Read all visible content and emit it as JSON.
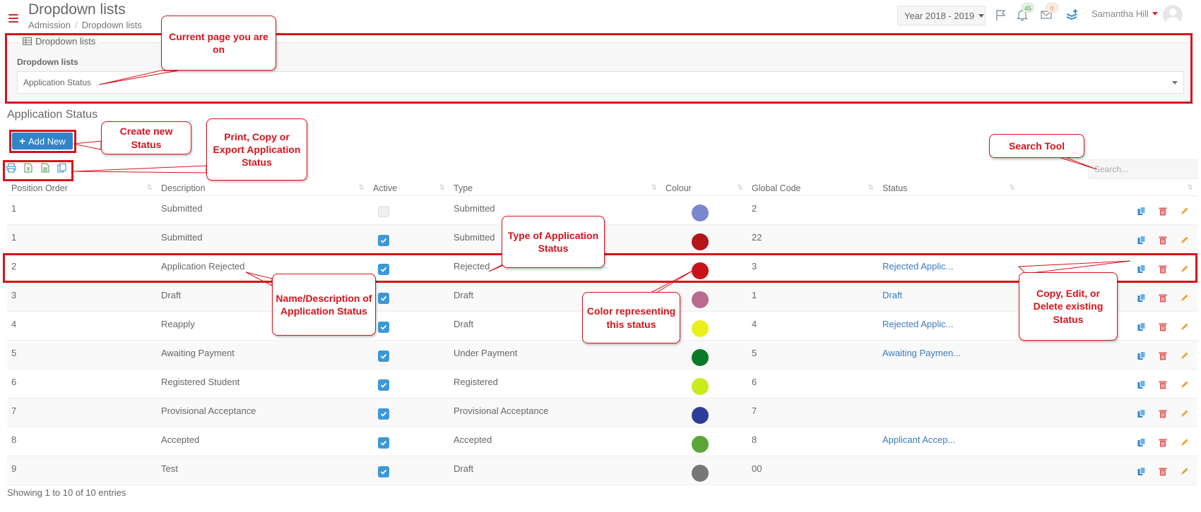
{
  "header": {
    "title": "Dropdown lists",
    "breadcrumb": [
      "Admission",
      "Dropdown lists"
    ],
    "year_select": "Year 2018 - 2019",
    "notifications_count": "45",
    "messages_count": "0",
    "user_name": "Samantha Hill"
  },
  "panel": {
    "legend": "Dropdown lists",
    "label": "Dropdown lists",
    "selected": "Application Status"
  },
  "section_title": "Application Status",
  "add_button": "Add New",
  "search": {
    "placeholder": "Search..."
  },
  "table": {
    "columns": [
      "Position Order",
      "Description",
      "Active",
      "Type",
      "Colour",
      "Global Code",
      "Status"
    ],
    "rows": [
      {
        "order": "1",
        "description": "Submitted",
        "active": false,
        "type": "Submitted",
        "colour": "#7b86cf",
        "global_code": "2",
        "status": ""
      },
      {
        "order": "1",
        "description": "Submitted",
        "active": true,
        "type": "Submitted",
        "colour": "#b3161a",
        "global_code": "22",
        "status": ""
      },
      {
        "order": "2",
        "description": "Application Rejected",
        "active": true,
        "type": "Rejected",
        "colour": "#c81418",
        "global_code": "3",
        "status": "Rejected Applic..."
      },
      {
        "order": "3",
        "description": "Draft",
        "active": true,
        "type": "Draft",
        "colour": "#b86a8f",
        "global_code": "1",
        "status": "Draft"
      },
      {
        "order": "4",
        "description": "Reapply",
        "active": true,
        "type": "Draft",
        "colour": "#eaf01c",
        "global_code": "4",
        "status": "Rejected Applic..."
      },
      {
        "order": "5",
        "description": "Awaiting Payment",
        "active": true,
        "type": "Under Payment",
        "colour": "#0b7a28",
        "global_code": "5",
        "status": "Awaiting Paymen..."
      },
      {
        "order": "6",
        "description": "Registered Student",
        "active": true,
        "type": "Registered",
        "colour": "#c8eb1b",
        "global_code": "6",
        "status": ""
      },
      {
        "order": "7",
        "description": "Provisional Acceptance",
        "active": true,
        "type": "Provisional Acceptance",
        "colour": "#2e3d98",
        "global_code": "7",
        "status": ""
      },
      {
        "order": "8",
        "description": "Accepted",
        "active": true,
        "type": "Accepted",
        "colour": "#5aa638",
        "global_code": "8",
        "status": "Applicant Accep..."
      },
      {
        "order": "9",
        "description": "Test",
        "active": true,
        "type": "Draft",
        "colour": "#777777",
        "global_code": "00",
        "status": ""
      }
    ]
  },
  "footer_info": "Showing 1 to 10 of 10 entries",
  "annotations": {
    "current_page": "Current page you are on",
    "create_new": "Create new Status",
    "print_copy_export": "Print, Copy or Export Application Status",
    "search_tool": "Search Tool",
    "type_of_status": "Type of Application Status",
    "name_description": "Name/Description of Application Status",
    "color_representing": "Color representing this status",
    "copy_edit_delete": "Copy, Edit, or Delete existing Status"
  },
  "colors": {
    "accent_red": "#d8121a",
    "primary_blue": "#2d86c7",
    "link_blue": "#3a7bbf"
  }
}
